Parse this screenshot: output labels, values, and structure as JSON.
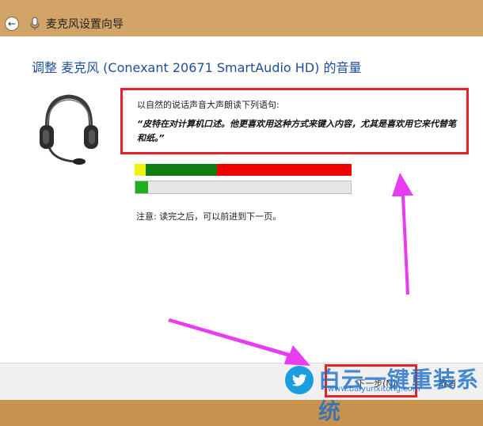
{
  "window": {
    "title": "麦克风设置向导"
  },
  "main": {
    "heading": "调整 麦克风 (Conexant 20671 SmartAudio HD) 的音量",
    "instruction": "以自然的说话声音大声朗读下列语句:",
    "read_text": "“皮特在对计算机口述。他更喜欢用这种方式来键入内容，尤其是喜欢用它来代替笔和纸。”",
    "note": "注意: 读完之后，可以前进到下一页。",
    "level_meter": {
      "zones": [
        {
          "name": "low",
          "fraction": 0.05,
          "color": "#f2f20f"
        },
        {
          "name": "good",
          "fraction": 0.33,
          "color": "#127d12"
        },
        {
          "name": "high",
          "fraction": 0.62,
          "color": "#f20000"
        }
      ]
    },
    "input_level": {
      "fraction": 0.06,
      "color": "#1fae1f"
    }
  },
  "footer": {
    "next_label": "下一步(N)",
    "cancel_label": "取消"
  },
  "watermark": {
    "brand": "白云一键重装系统",
    "url": "www.baiyunxitong.com"
  },
  "colors": {
    "highlight": "#e8202a",
    "arrow": "#e83cf0",
    "heading": "#1f4e9a"
  },
  "icons": [
    "back-arrow-icon",
    "microphone-icon",
    "headset-icon",
    "twitter-bird-icon"
  ]
}
